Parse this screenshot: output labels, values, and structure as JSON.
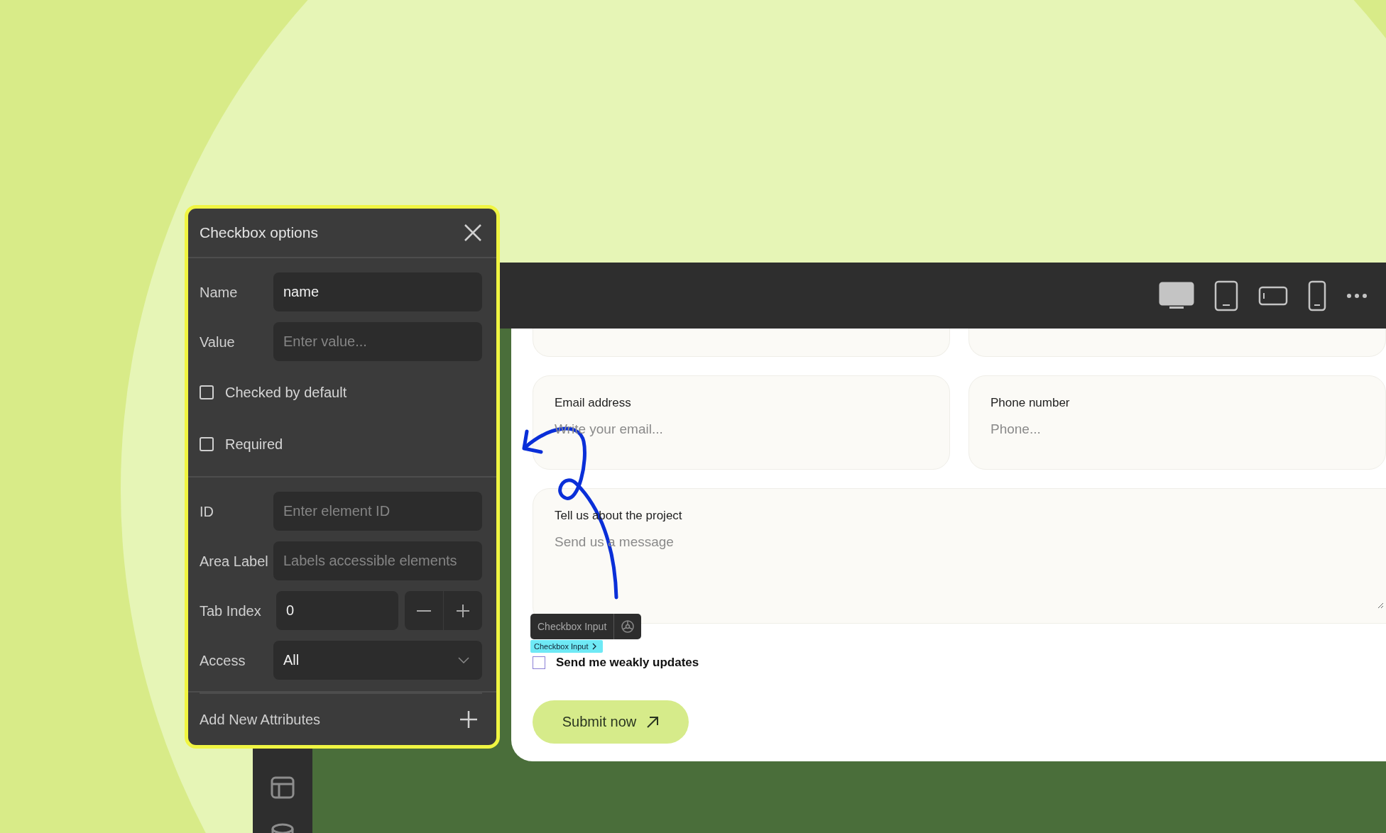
{
  "toolbar": {
    "devices": [
      {
        "kind": "desktop",
        "selected": true
      },
      {
        "kind": "tablet",
        "selected": false
      },
      {
        "kind": "tablet-landscape",
        "selected": false
      },
      {
        "kind": "phone",
        "selected": false
      }
    ]
  },
  "panel": {
    "title": "Checkbox options",
    "groups": [
      [
        {
          "kind": "input",
          "label": "Name",
          "value": "name"
        },
        {
          "kind": "input",
          "label": "Value",
          "placeholder": "Enter value..."
        },
        {
          "kind": "checkbox",
          "label": "Checked by default",
          "checked": false
        },
        {
          "kind": "checkbox",
          "label": "Required",
          "checked": false
        }
      ],
      [
        {
          "kind": "input",
          "label": "ID",
          "placeholder": "Enter element ID"
        },
        {
          "kind": "input",
          "label": "Area Label",
          "placeholder": "Labels accessible elements"
        },
        {
          "kind": "stepper",
          "label": "Tab Index",
          "value": "0"
        },
        {
          "kind": "select",
          "label": "Access",
          "value": "All"
        }
      ]
    ],
    "add_label": "Add New Attributes"
  },
  "form": {
    "fields": [
      {
        "kind": "input",
        "label": "Email address",
        "placeholder": "Write your email..."
      },
      {
        "kind": "input",
        "label": "Phone number",
        "placeholder": "Phone..."
      },
      {
        "kind": "textarea",
        "label": "Tell us about the project",
        "placeholder": "Send us a message"
      }
    ],
    "selection_toolbar": {
      "label": "Checkbox Input"
    },
    "selection_tag": "Checkbox Input",
    "checkbox": {
      "label": "Send me weakly updates",
      "checked": false
    },
    "submit": "Submit now"
  }
}
